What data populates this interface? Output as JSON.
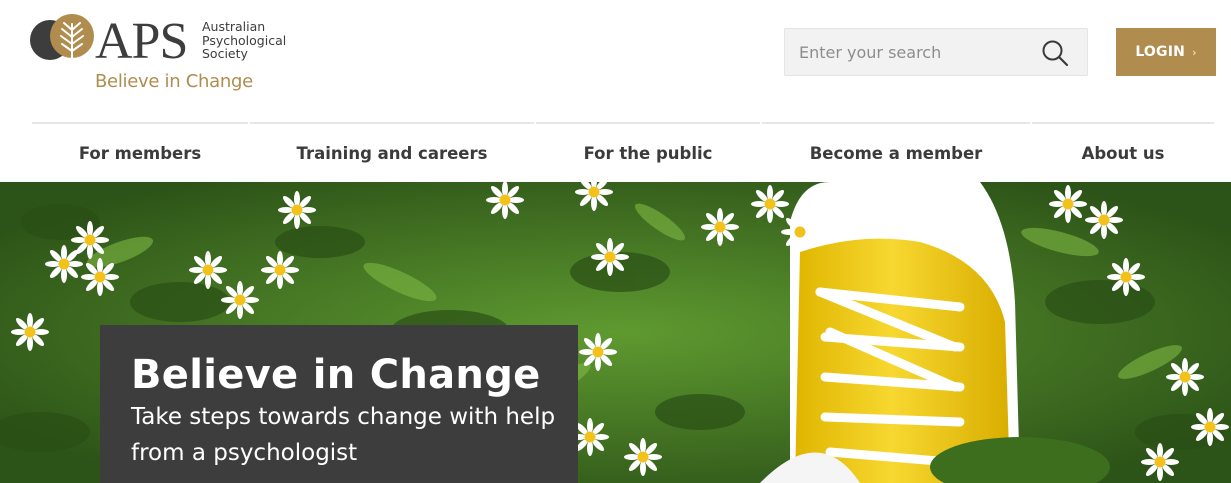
{
  "brand": {
    "acronym": "APS",
    "org_line1": "Australian",
    "org_line2": "Psychological",
    "org_line3": "Society",
    "tagline": "Believe in Change",
    "gold": "#b08d4f",
    "dark": "#3d3d3d"
  },
  "search": {
    "placeholder": "Enter your search",
    "icon": "search-icon"
  },
  "login": {
    "label": "LOGIN",
    "arrow": "›"
  },
  "nav": {
    "items": [
      {
        "label": "For members"
      },
      {
        "label": "Training and careers"
      },
      {
        "label": "For the public"
      },
      {
        "label": "Become a member"
      },
      {
        "label": "About us"
      }
    ]
  },
  "hero": {
    "title": "Believe in Change",
    "subtitle": "Take steps towards change with help from a psychologist",
    "image": "yellow-sneaker-on-grass-with-daisies"
  }
}
